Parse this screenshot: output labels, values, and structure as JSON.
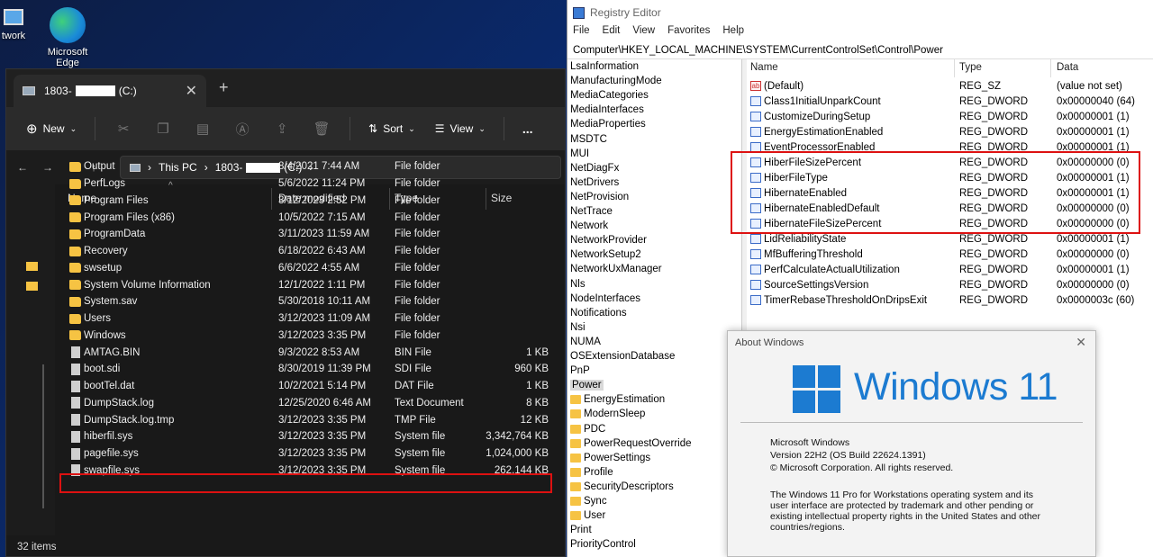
{
  "desktop": {
    "icons": [
      {
        "label": "twork"
      },
      {
        "label": "Microsoft Edge"
      }
    ]
  },
  "explorer": {
    "tab_title": "1803-",
    "tab_drive": "(C:)",
    "toolbar": {
      "new": "New",
      "sort": "Sort",
      "view": "View",
      "more": "..."
    },
    "breadcrumb": [
      "This PC",
      "1803-",
      "(C:)"
    ],
    "columns": [
      "Name",
      "Date modified",
      "Type",
      "Size"
    ],
    "files": [
      {
        "name": "Output",
        "date": "8/4/2021 7:44 AM",
        "type": "File folder",
        "size": "",
        "folder": true
      },
      {
        "name": "PerfLogs",
        "date": "5/6/2022 11:24 PM",
        "type": "File folder",
        "size": "",
        "folder": true
      },
      {
        "name": "Program Files",
        "date": "3/12/2023 2:52 PM",
        "type": "File folder",
        "size": "",
        "folder": true
      },
      {
        "name": "Program Files (x86)",
        "date": "10/5/2022 7:15 AM",
        "type": "File folder",
        "size": "",
        "folder": true
      },
      {
        "name": "ProgramData",
        "date": "3/11/2023 11:59 AM",
        "type": "File folder",
        "size": "",
        "folder": true
      },
      {
        "name": "Recovery",
        "date": "6/18/2022 6:43 AM",
        "type": "File folder",
        "size": "",
        "folder": true
      },
      {
        "name": "swsetup",
        "date": "6/6/2022 4:55 AM",
        "type": "File folder",
        "size": "",
        "folder": true
      },
      {
        "name": "System Volume Information",
        "date": "12/1/2022 1:11 PM",
        "type": "File folder",
        "size": "",
        "folder": true
      },
      {
        "name": "System.sav",
        "date": "5/30/2018 10:11 AM",
        "type": "File folder",
        "size": "",
        "folder": true
      },
      {
        "name": "Users",
        "date": "3/12/2023 11:09 AM",
        "type": "File folder",
        "size": "",
        "folder": true
      },
      {
        "name": "Windows",
        "date": "3/12/2023 3:35 PM",
        "type": "File folder",
        "size": "",
        "folder": true
      },
      {
        "name": "AMTAG.BIN",
        "date": "9/3/2022 8:53 AM",
        "type": "BIN File",
        "size": "1 KB",
        "folder": false
      },
      {
        "name": "boot.sdi",
        "date": "8/30/2019 11:39 PM",
        "type": "SDI File",
        "size": "960 KB",
        "folder": false
      },
      {
        "name": "bootTel.dat",
        "date": "10/2/2021 5:14 PM",
        "type": "DAT File",
        "size": "1 KB",
        "folder": false
      },
      {
        "name": "DumpStack.log",
        "date": "12/25/2020 6:46 AM",
        "type": "Text Document",
        "size": "8 KB",
        "folder": false
      },
      {
        "name": "DumpStack.log.tmp",
        "date": "3/12/2023 3:35 PM",
        "type": "TMP File",
        "size": "12 KB",
        "folder": false
      },
      {
        "name": "hiberfil.sys",
        "date": "3/12/2023 3:35 PM",
        "type": "System file",
        "size": "3,342,764 KB",
        "folder": false
      },
      {
        "name": "pagefile.sys",
        "date": "3/12/2023 3:35 PM",
        "type": "System file",
        "size": "1,024,000 KB",
        "folder": false
      },
      {
        "name": "swapfile.sys",
        "date": "3/12/2023 3:35 PM",
        "type": "System file",
        "size": "262,144 KB",
        "folder": false
      }
    ],
    "status": "32 items"
  },
  "registry": {
    "title": "Registry Editor",
    "menu": [
      "File",
      "Edit",
      "View",
      "Favorites",
      "Help"
    ],
    "path": "Computer\\HKEY_LOCAL_MACHINE\\SYSTEM\\CurrentControlSet\\Control\\Power",
    "tree": [
      {
        "label": "LsaInformation",
        "indent": 0
      },
      {
        "label": "ManufacturingMode",
        "indent": 0
      },
      {
        "label": "MediaCategories",
        "indent": 0
      },
      {
        "label": "MediaInterfaces",
        "indent": 0
      },
      {
        "label": "MediaProperties",
        "indent": 0
      },
      {
        "label": "MSDTC",
        "indent": 0
      },
      {
        "label": "MUI",
        "indent": 0
      },
      {
        "label": "NetDiagFx",
        "indent": 0
      },
      {
        "label": "NetDrivers",
        "indent": 0
      },
      {
        "label": "NetProvision",
        "indent": 0
      },
      {
        "label": "NetTrace",
        "indent": 0
      },
      {
        "label": "Network",
        "indent": 0
      },
      {
        "label": "NetworkProvider",
        "indent": 0
      },
      {
        "label": "NetworkSetup2",
        "indent": 0
      },
      {
        "label": "NetworkUxManager",
        "indent": 0
      },
      {
        "label": "Nls",
        "indent": 0
      },
      {
        "label": "NodeInterfaces",
        "indent": 0
      },
      {
        "label": "Notifications",
        "indent": 0
      },
      {
        "label": "Nsi",
        "indent": 0
      },
      {
        "label": "NUMA",
        "indent": 0
      },
      {
        "label": "OSExtensionDatabase",
        "indent": 0
      },
      {
        "label": "PnP",
        "indent": 0
      },
      {
        "label": "Power",
        "indent": 0,
        "selected": true
      },
      {
        "label": "EnergyEstimation",
        "indent": 1
      },
      {
        "label": "ModernSleep",
        "indent": 1
      },
      {
        "label": "PDC",
        "indent": 1
      },
      {
        "label": "PowerRequestOverride",
        "indent": 1
      },
      {
        "label": "PowerSettings",
        "indent": 1
      },
      {
        "label": "Profile",
        "indent": 1
      },
      {
        "label": "SecurityDescriptors",
        "indent": 1
      },
      {
        "label": "Sync",
        "indent": 1
      },
      {
        "label": "User",
        "indent": 1
      },
      {
        "label": "Print",
        "indent": 0
      },
      {
        "label": "PriorityControl",
        "indent": 0
      }
    ],
    "columns": [
      "Name",
      "Type",
      "Data"
    ],
    "values": [
      {
        "name": "(Default)",
        "type": "REG_SZ",
        "data": "(value not set)"
      },
      {
        "name": "Class1InitialUnparkCount",
        "type": "REG_DWORD",
        "data": "0x00000040 (64)"
      },
      {
        "name": "CustomizeDuringSetup",
        "type": "REG_DWORD",
        "data": "0x00000001 (1)"
      },
      {
        "name": "EnergyEstimationEnabled",
        "type": "REG_DWORD",
        "data": "0x00000001 (1)"
      },
      {
        "name": "EventProcessorEnabled",
        "type": "REG_DWORD",
        "data": "0x00000001 (1)"
      },
      {
        "name": "HiberFileSizePercent",
        "type": "REG_DWORD",
        "data": "0x00000000 (0)"
      },
      {
        "name": "HiberFileType",
        "type": "REG_DWORD",
        "data": "0x00000001 (1)"
      },
      {
        "name": "HibernateEnabled",
        "type": "REG_DWORD",
        "data": "0x00000001 (1)"
      },
      {
        "name": "HibernateEnabledDefault",
        "type": "REG_DWORD",
        "data": "0x00000000 (0)"
      },
      {
        "name": "HibernateFileSizePercent",
        "type": "REG_DWORD",
        "data": "0x00000000 (0)"
      },
      {
        "name": "LidReliabilityState",
        "type": "REG_DWORD",
        "data": "0x00000001 (1)"
      },
      {
        "name": "MfBufferingThreshold",
        "type": "REG_DWORD",
        "data": "0x00000000 (0)"
      },
      {
        "name": "PerfCalculateActualUtilization",
        "type": "REG_DWORD",
        "data": "0x00000001 (1)"
      },
      {
        "name": "SourceSettingsVersion",
        "type": "REG_DWORD",
        "data": "0x00000000 (0)"
      },
      {
        "name": "TimerRebaseThresholdOnDripsExit",
        "type": "REG_DWORD",
        "data": "0x0000003c (60)"
      }
    ]
  },
  "about": {
    "title": "About Windows",
    "brand": "Windows 11",
    "line1": "Microsoft Windows",
    "line2": "Version 22H2 (OS Build 22624.1391)",
    "line3": "© Microsoft Corporation. All rights reserved.",
    "legal": "The Windows 11 Pro for Workstations operating system and its user interface are protected by trademark and other pending or existing intellectual property rights in the United States and other countries/regions."
  },
  "colors": {
    "accent": "#1c7bd1",
    "highlight": "#d11111",
    "folder": "#f6c343"
  }
}
